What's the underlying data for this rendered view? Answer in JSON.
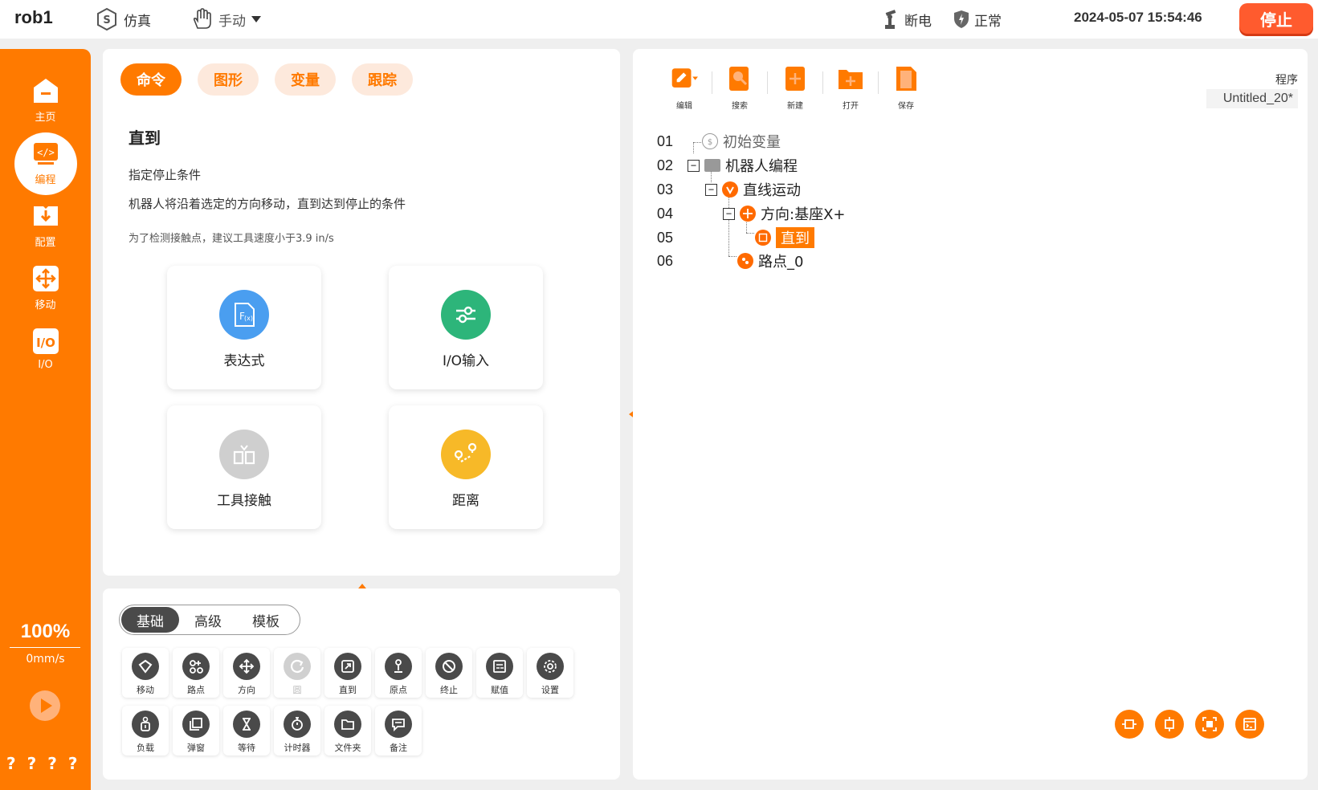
{
  "topbar": {
    "robot_name": "rob1",
    "mode": "仿真",
    "control": "手动",
    "power": "断电",
    "status": "正常",
    "datetime": "2024-05-07 15:54:46",
    "stop_label": "停止"
  },
  "sidebar": {
    "items": [
      {
        "label": "主页",
        "icon": "home-icon"
      },
      {
        "label": "编程",
        "icon": "code-icon"
      },
      {
        "label": "配置",
        "icon": "config-icon"
      },
      {
        "label": "移动",
        "icon": "move-icon"
      },
      {
        "label": "I/O",
        "icon": "io-icon"
      }
    ],
    "speed_percent": "100%",
    "speed_value": "0mm/s",
    "help_marks": [
      "?",
      "?",
      "?",
      "?"
    ]
  },
  "command_panel": {
    "tabs": [
      "命令",
      "图形",
      "变量",
      "跟踪"
    ],
    "active_tab": "命令",
    "title": "直到",
    "desc1": "指定停止条件",
    "desc2": "机器人将沿着选定的方向移动，直到达到停止的条件",
    "hint": "为了检测接触点，建议工具速度小于3.9 in/s",
    "cards": [
      {
        "label": "表达式",
        "color": "#4a9ef0"
      },
      {
        "label": "I/O输入",
        "color": "#2db57a"
      },
      {
        "label": "工具接触",
        "color": "#cfcfcf"
      },
      {
        "label": "距离",
        "color": "#f7b928"
      }
    ]
  },
  "tool_panel": {
    "segments": [
      "基础",
      "高级",
      "模板"
    ],
    "active_segment": "基础",
    "tools_row1": [
      "移动",
      "路点",
      "方向",
      "圆",
      "直到",
      "原点",
      "终止",
      "赋值",
      "设置"
    ],
    "tools_row2": [
      "负载",
      "弹窗",
      "等待",
      "计时器",
      "文件夹",
      "备注"
    ]
  },
  "program_panel": {
    "toolbar": [
      "编辑",
      "搜索",
      "新建",
      "打开",
      "保存"
    ],
    "program_label": "程序",
    "program_name": "Untitled_20*",
    "lines": [
      {
        "num": "01",
        "text": "初始变量"
      },
      {
        "num": "02",
        "text": "机器人编程"
      },
      {
        "num": "03",
        "text": "直线运动"
      },
      {
        "num": "04",
        "text": "方向:基座X+"
      },
      {
        "num": "05",
        "text": "直到"
      },
      {
        "num": "06",
        "text": "路点_0"
      }
    ]
  },
  "colors": {
    "accent": "#ff7a00",
    "stop": "#ff5b2e"
  }
}
